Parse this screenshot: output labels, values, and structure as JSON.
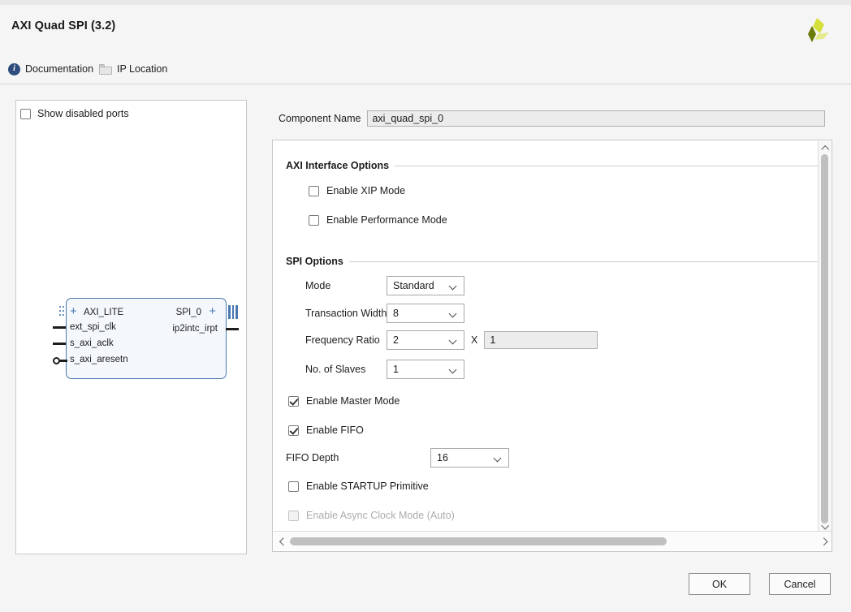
{
  "window": {
    "title": "AXI Quad SPI (3.2)",
    "logo_name": "xilinx-logo"
  },
  "toolbar": {
    "documentation_label": "Documentation",
    "ip_location_label": "IP Location"
  },
  "left_panel": {
    "show_disabled_ports_label": "Show disabled ports",
    "show_disabled_ports_checked": false,
    "diagram": {
      "bus_in_label": "AXI_LITE",
      "ports_in": [
        "ext_spi_clk",
        "s_axi_aclk",
        "s_axi_aresetn"
      ],
      "bus_out_label": "SPI_0",
      "ports_out": [
        "ip2intc_irpt"
      ],
      "plus_glyph": "+"
    }
  },
  "component": {
    "label": "Component Name",
    "value": "axi_quad_spi_0",
    "placeholder": ""
  },
  "options": {
    "axi_section": {
      "title": "AXI Interface Options",
      "checkboxes": [
        {
          "label": "Enable XIP Mode",
          "checked": false,
          "disabled": false
        },
        {
          "label": "Enable Performance Mode",
          "checked": false,
          "disabled": false
        }
      ]
    },
    "spi_section": {
      "title": "SPI Options",
      "fields": [
        {
          "label": "Mode",
          "value": "Standard"
        },
        {
          "label": "Transaction Width",
          "value": "8"
        },
        {
          "label": "Frequency Ratio",
          "value": "2"
        },
        {
          "label": "No. of Slaves",
          "value": "1"
        }
      ],
      "freq_multiplier_symbol": "X",
      "freq_multiplier_value": "1",
      "master_mode": {
        "label": "Enable Master Mode",
        "checked": true,
        "disabled": false
      },
      "fifo": {
        "label": "Enable FIFO",
        "checked": true,
        "disabled": false
      },
      "fifo_depth": {
        "label": "FIFO Depth",
        "value": "16"
      },
      "startup": {
        "label": "Enable STARTUP Primitive",
        "checked": false,
        "disabled": false
      },
      "async_clock": {
        "label": "Enable Async Clock Mode (Auto)",
        "checked": false,
        "disabled": true
      }
    }
  },
  "footer": {
    "ok_label": "OK",
    "cancel_label": "Cancel"
  },
  "colors": {
    "dialog_bg": "#f5f5f5",
    "panel_bg": "#ffffff",
    "block_border": "#4a78b0",
    "block_fill": "#f4f8fc",
    "accent_info": "#2d4b7c",
    "logo_light": "#d6e03a",
    "logo_dark": "#6b7a08"
  }
}
